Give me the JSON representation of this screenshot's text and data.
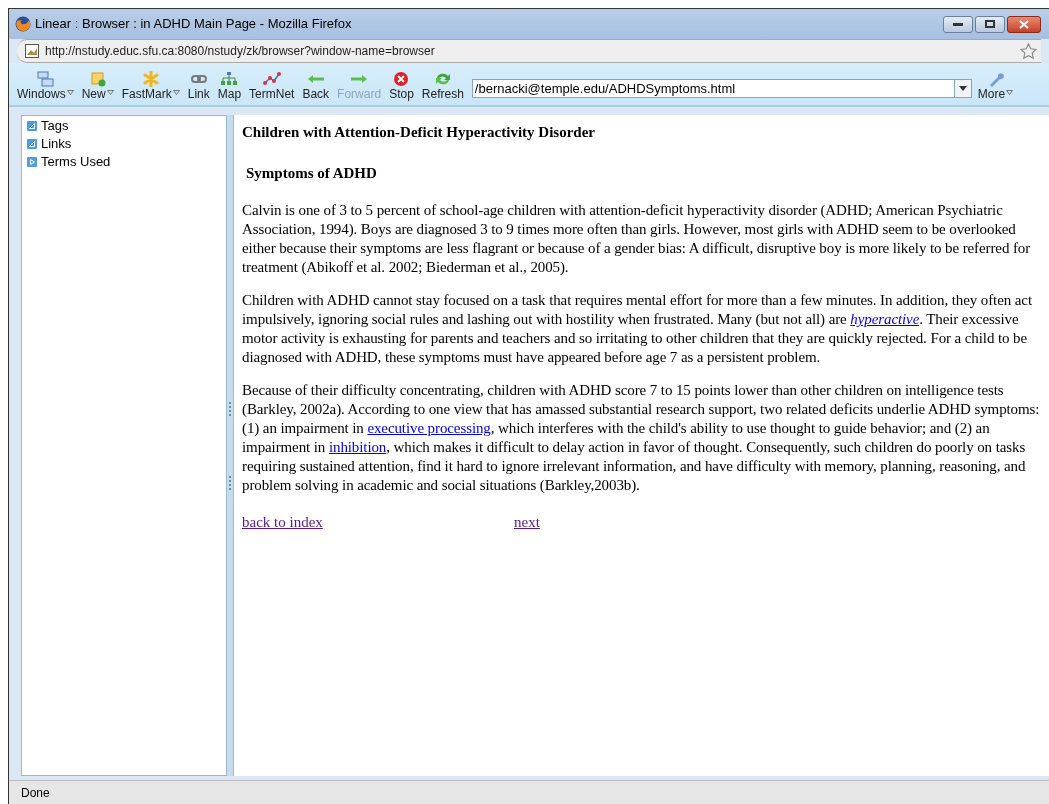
{
  "window": {
    "title": "Linear : Browser : in ADHD Main Page - Mozilla Firefox"
  },
  "address_bar": {
    "url": "http://nstudy.educ.sfu.ca:8080/nstudy/zk/browser?window-name=browser"
  },
  "toolbar": {
    "items": [
      {
        "label": "Windows",
        "menu": true,
        "disabled": false
      },
      {
        "label": "New",
        "menu": true,
        "disabled": false
      },
      {
        "label": "FastMark",
        "menu": true,
        "disabled": false
      },
      {
        "label": "Link",
        "menu": false,
        "disabled": false
      },
      {
        "label": "Map",
        "menu": false,
        "disabled": false
      },
      {
        "label": "TermNet",
        "menu": false,
        "disabled": false
      },
      {
        "label": "Back",
        "menu": false,
        "disabled": false
      },
      {
        "label": "Forward",
        "menu": false,
        "disabled": true
      },
      {
        "label": "Stop",
        "menu": false,
        "disabled": false
      },
      {
        "label": "Refresh",
        "menu": false,
        "disabled": false
      }
    ],
    "location": {
      "value": "/bernacki@temple.edu/ADHDSymptoms.html"
    },
    "more": {
      "label": "More",
      "menu": true
    }
  },
  "sidebar": {
    "items": [
      {
        "label": "Tags",
        "expanded": true
      },
      {
        "label": "Links",
        "expanded": true
      },
      {
        "label": "Terms Used",
        "expanded": false
      }
    ]
  },
  "document": {
    "title": "Children with Attention-Deficit Hyperactivity Disorder",
    "heading": "Symptoms of ADHD",
    "paragraphs": [
      [
        {
          "kind": "text",
          "text": "Calvin is one of 3 to 5 percent of school-age children with attention-deficit hyperactivity disorder (ADHD; American Psychiatric Association, 1994). Boys are diagnosed 3 to 9 times more often than girls. However, most girls with ADHD seem to be overlooked either because their symptoms are less flagrant or because of a gender bias: A difficult, disruptive boy is more likely to be referred for treatment (Abikoff et al. 2002; Biederman et al., 2005)."
        }
      ],
      [
        {
          "kind": "text",
          "text": "Children with ADHD cannot stay focused on a task that requires mental effort for more than a few minutes. In addition, they often act impulsively, ignoring social rules and lashing out with hostility when frustrated. Many (but not all) are "
        },
        {
          "kind": "link",
          "text": "hyperactive",
          "italic": true
        },
        {
          "kind": "text",
          "text": ". Their excessive motor activity is exhausting for parents and teachers and so irritating to other children that they are quickly rejected. For a child to be diagnosed with ADHD, these symptoms must have appeared before age 7 as a persistent problem."
        }
      ],
      [
        {
          "kind": "text",
          "text": "Because of their difficulty concentrating, children with ADHD score 7 to 15 points lower than other children on intelligence tests (Barkley, 2002a). According to one view that has amassed substantial research support, two related deficits underlie ADHD symptoms: (1) an impairment in "
        },
        {
          "kind": "link",
          "text": "executive processing",
          "italic": false
        },
        {
          "kind": "text",
          "text": ",  which interferes with the child's ability to use thought to guide behavior; and (2) an impairment in "
        },
        {
          "kind": "link",
          "text": "inhibition",
          "italic": false
        },
        {
          "kind": "text",
          "text": ", which makes it difficult to delay action in favor of thought. Consequently, such children do poorly on tasks requiring sustained attention, find it hard to ignore irrelevant information, and have difficulty with memory, planning, reasoning, and problem solving in academic and social situations (Barkley,2003b)."
        }
      ]
    ],
    "nav_links": [
      "back to index",
      "next"
    ]
  },
  "status_bar": {
    "text": "Done"
  }
}
